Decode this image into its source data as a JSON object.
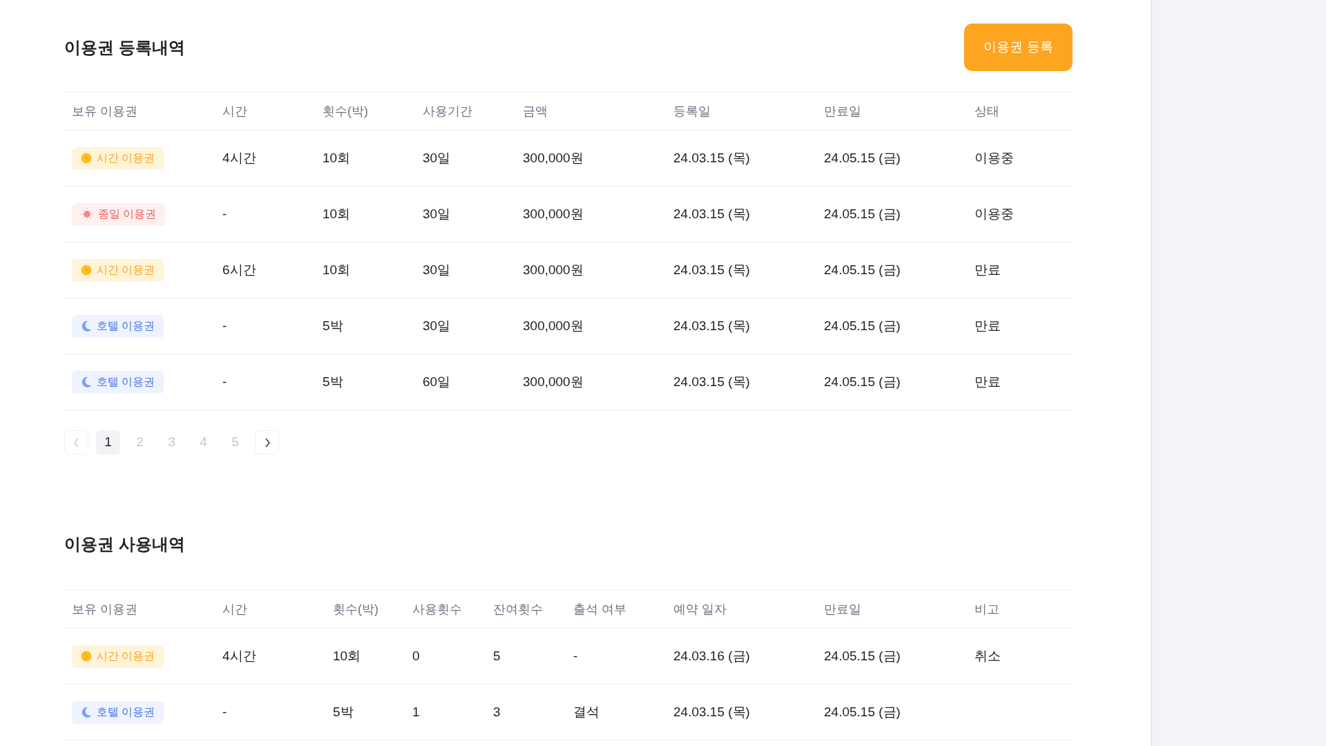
{
  "registrations": {
    "title": "이용권 등록내역",
    "register_button": "이용권 등록",
    "columns": [
      "보유 이용권",
      "시간",
      "횟수(박)",
      "사용기간",
      "금액",
      "등록일",
      "만료일",
      "상태"
    ],
    "rows": [
      {
        "cells": [
          {
            "kind": "time",
            "label": "시간 이용권"
          },
          "4시간",
          "10회",
          "30일",
          "300,000원",
          "24.03.15 (목)",
          "24.05.15 (금)",
          "이용중"
        ]
      },
      {
        "cells": [
          {
            "kind": "allday",
            "label": "종일 이용권"
          },
          "-",
          "10회",
          "30일",
          "300,000원",
          "24.03.15 (목)",
          "24.05.15 (금)",
          "이용중"
        ]
      },
      {
        "cells": [
          {
            "kind": "time",
            "label": "시간 이용권"
          },
          "6시간",
          "10회",
          "30일",
          "300,000원",
          "24.03.15 (목)",
          "24.05.15 (금)",
          "만료"
        ]
      },
      {
        "cells": [
          {
            "kind": "hotel",
            "label": "호텔 이용권"
          },
          "-",
          "5박",
          "30일",
          "300,000원",
          "24.03.15 (목)",
          "24.05.15 (금)",
          "만료"
        ]
      },
      {
        "cells": [
          {
            "kind": "hotel",
            "label": "호텔 이용권"
          },
          "-",
          "5박",
          "60일",
          "300,000원",
          "24.03.15 (목)",
          "24.05.15 (금)",
          "만료"
        ]
      }
    ],
    "pagination": {
      "prev_disabled": true,
      "next_disabled": false,
      "pages": [
        {
          "label": "1",
          "selected": true
        },
        {
          "label": "2",
          "selected": false
        },
        {
          "label": "3",
          "selected": false
        },
        {
          "label": "4",
          "selected": false
        },
        {
          "label": "5",
          "selected": false
        }
      ]
    }
  },
  "usage": {
    "title": "이용권 사용내역",
    "columns": [
      "보유 이용권",
      "시간",
      "횟수(박)",
      "사용횟수",
      "잔여횟수",
      "출석 여부",
      "예약 일자",
      "만료일",
      "비고"
    ],
    "rows": [
      {
        "cells": [
          {
            "kind": "time",
            "label": "시간 이용권"
          },
          "4시간",
          "10회",
          "0",
          "5",
          "-",
          "24.03.16 (금)",
          "24.05.15 (금)",
          "취소"
        ]
      },
      {
        "cells": [
          {
            "kind": "hotel",
            "label": "호텔 이용권"
          },
          "-",
          "5박",
          "1",
          "3",
          "결석",
          "24.03.15 (목)",
          "24.05.15 (금)",
          ""
        ]
      }
    ]
  }
}
